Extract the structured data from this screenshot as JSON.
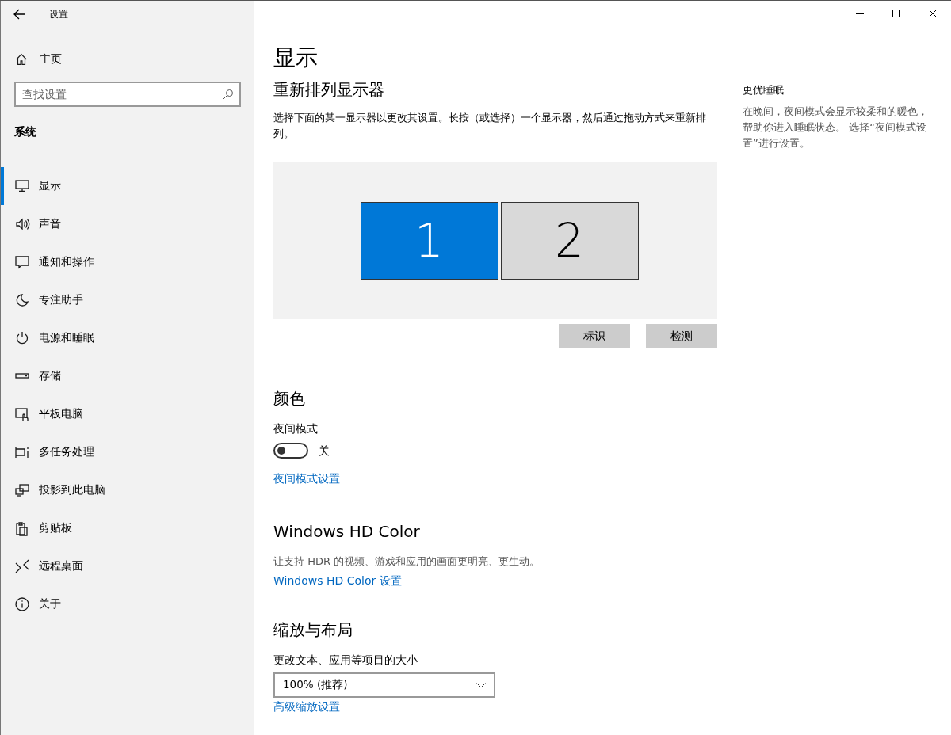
{
  "window": {
    "title": "设置"
  },
  "sidebar": {
    "home": "主页",
    "search": {
      "placeholder": "查找设置"
    },
    "section": "系统",
    "items": [
      {
        "label": "显示",
        "selected": true
      },
      {
        "label": "声音",
        "selected": false
      },
      {
        "label": "通知和操作",
        "selected": false
      },
      {
        "label": "专注助手",
        "selected": false
      },
      {
        "label": "电源和睡眠",
        "selected": false
      },
      {
        "label": "存储",
        "selected": false
      },
      {
        "label": "平板电脑",
        "selected": false
      },
      {
        "label": "多任务处理",
        "selected": false
      },
      {
        "label": "投影到此电脑",
        "selected": false
      },
      {
        "label": "剪贴板",
        "selected": false
      },
      {
        "label": "远程桌面",
        "selected": false
      },
      {
        "label": "关于",
        "selected": false
      }
    ]
  },
  "page": {
    "title": "显示"
  },
  "arrange": {
    "heading": "重新排列显示器",
    "description": "选择下面的某一显示器以更改其设置。长按（或选择）一个显示器，然后通过拖动方式来重新排列。",
    "monitors": [
      {
        "label": "1",
        "selected": true
      },
      {
        "label": "2",
        "selected": false
      }
    ],
    "buttons": [
      "标识",
      "检测"
    ]
  },
  "color": {
    "heading": "颜色",
    "night_light": {
      "label": "夜间模式",
      "on": false,
      "state_text": "关"
    },
    "link": "夜间模式设置"
  },
  "hd_color": {
    "heading": "Windows HD Color",
    "description": "让支持 HDR 的视频、游戏和应用的画面更明亮、更生动。",
    "link": "Windows HD Color 设置"
  },
  "scale": {
    "heading": "缩放与布局",
    "label": "更改文本、应用等项目的大小",
    "dropdown": {
      "value": "100% (推荐)"
    },
    "link": "高级缩放设置"
  },
  "aside": {
    "heading": "更优睡眠",
    "text": "在晚间，夜间模式会显示较柔和的暖色，帮助你进入睡眠状态。 选择“夜间模式设置”进行设置。"
  }
}
